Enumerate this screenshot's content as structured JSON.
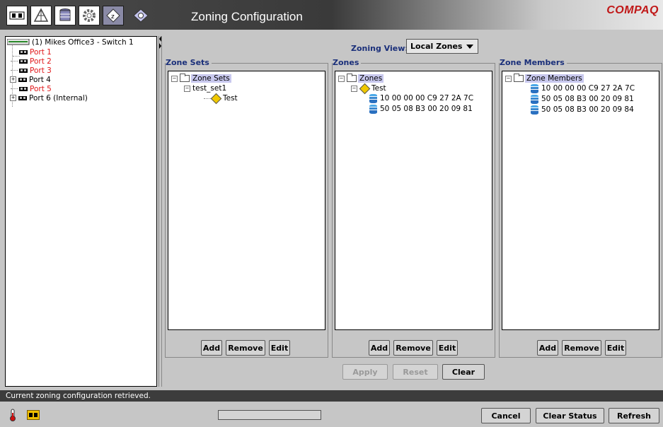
{
  "header": {
    "title": "Zoning Configuration",
    "brand": "COMPAQ",
    "toolbar": [
      {
        "icon": "ports-icon"
      },
      {
        "icon": "fabric-icon"
      },
      {
        "icon": "storage-icon"
      },
      {
        "icon": "settings-gear-icon"
      },
      {
        "icon": "zoning-icon"
      },
      {
        "icon": "zoning-config-icon"
      }
    ]
  },
  "tree": {
    "root": "(1) Mikes Office3 - Switch 1",
    "ports": [
      {
        "label": "Port 1",
        "color": "#e0181a",
        "expandable": false
      },
      {
        "label": "Port 2",
        "color": "#e0181a",
        "expandable": false
      },
      {
        "label": "Port 3",
        "color": "#e0181a",
        "expandable": false
      },
      {
        "label": "Port 4",
        "color": "#000000",
        "expandable": true
      },
      {
        "label": "Port 5",
        "color": "#e0181a",
        "expandable": false
      },
      {
        "label": "Port 6 (Internal)",
        "color": "#000000",
        "expandable": true
      }
    ]
  },
  "zoning_view": {
    "label": "Zoning View:",
    "selected": "Local Zones"
  },
  "zone_sets": {
    "title": "Zone Sets",
    "root": "Zone Sets",
    "set": "test_set1",
    "zone": "Test",
    "buttons": {
      "add": "Add",
      "remove": "Remove",
      "edit": "Edit"
    }
  },
  "zones": {
    "title": "Zones",
    "root": "Zones",
    "zone": "Test",
    "members": [
      "10 00 00 00 C9 27 2A 7C",
      "50 05 08 B3 00 20 09 81"
    ],
    "buttons": {
      "add": "Add",
      "remove": "Remove",
      "edit": "Edit"
    }
  },
  "zone_members": {
    "title": "Zone Members",
    "root": "Zone Members",
    "members": [
      "10 00 00 00 C9 27 2A 7C",
      "50 05 08 B3 00 20 09 81",
      "50 05 08 B3 00 20 09 84"
    ],
    "buttons": {
      "add": "Add",
      "remove": "Remove",
      "edit": "Edit"
    }
  },
  "actions": {
    "apply": "Apply",
    "reset": "Reset",
    "clear": "Clear"
  },
  "status": {
    "message": "Current zoning configuration retrieved.",
    "progress": 0,
    "cancel": "Cancel",
    "clear_status": "Clear Status",
    "refresh": "Refresh"
  },
  "colors": {
    "accent_title": "#1a2f7a",
    "port_offline": "#e0181a",
    "brand": "#c01818"
  }
}
